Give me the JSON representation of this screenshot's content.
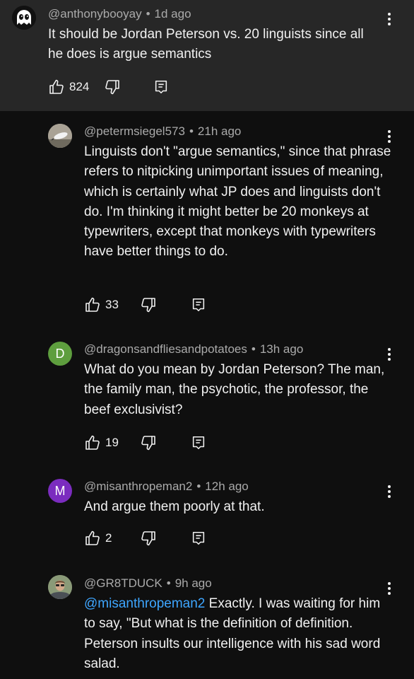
{
  "comments": [
    {
      "author": "@anthonybooyay",
      "time": "1d ago",
      "text": "It should be Jordan Peterson vs. 20 linguists since all he does is argue semantics",
      "likes": "824",
      "avatar_icon": "ghost-avatar-icon"
    },
    {
      "author": "@petermsiegel573",
      "time": "21h ago",
      "text": "Linguists don't \"argue semantics,\" since that phrase refers to nitpicking unimportant issues of meaning, which is certainly what JP does and linguists don't do. I'm thinking it might better be 20 monkeys at typewriters, except that monkeys with typewriters have better things to do.",
      "likes": "33",
      "avatar_icon": "bird-photo-avatar-icon"
    },
    {
      "author": "@dragonsandfliesandpotatoes",
      "time": "13h ago",
      "text": "What do you mean by Jordan Peterson? The man, the family man, the psychotic, the professor, the beef exclusivist?",
      "likes": "19",
      "avatar_letter": "D",
      "avatar_color": "#5e9e3e"
    },
    {
      "author": "@misanthropeman2",
      "time": "12h ago",
      "text": "And argue them poorly at that.",
      "likes": "2",
      "avatar_letter": "M",
      "avatar_color": "#7b2cbf"
    },
    {
      "author": "@GR8TDUCK",
      "time": "9h ago",
      "mention": "@misanthropeman2",
      "text": " Exactly. I was waiting for him to say, \"But what is the definition of definition. Peterson insults our intelligence with his sad word salad.",
      "avatar_icon": "person-photo-avatar-icon"
    }
  ],
  "separator": "•",
  "colors": {
    "background": "#0f0f0f",
    "highlight": "#272727",
    "mention": "#3ea6ff",
    "meta": "#aaaaaa"
  }
}
